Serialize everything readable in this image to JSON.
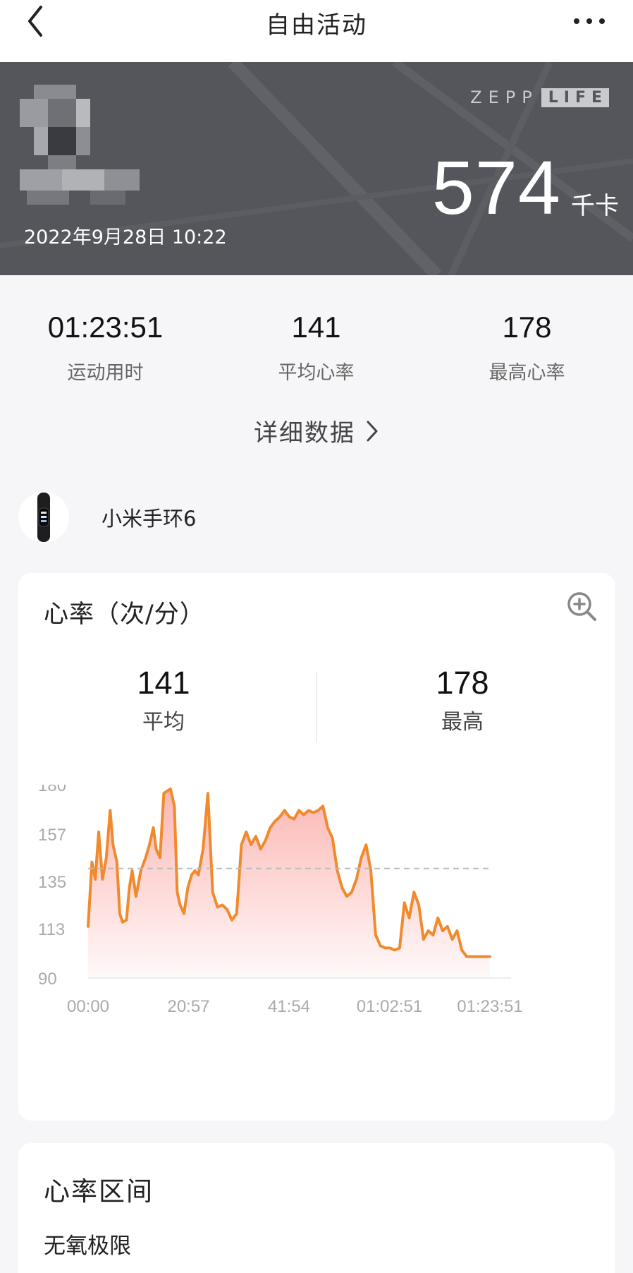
{
  "nav": {
    "title": "自由活动",
    "back_icon": "chevron-left-icon",
    "more_icon": "more-dots-icon"
  },
  "hero": {
    "brand_left": "ZEPP",
    "brand_right": "LIFE",
    "date": "2022年9月28日 10:22",
    "calories": "574",
    "calories_unit": "千卡"
  },
  "stats": [
    {
      "value": "01:23:51",
      "label": "运动用时"
    },
    {
      "value": "141",
      "label": "平均心率"
    },
    {
      "value": "178",
      "label": "最高心率"
    }
  ],
  "detail_link": "详细数据",
  "device": {
    "name": "小米手环6"
  },
  "heart_rate_card": {
    "title": "心率（次/分）",
    "zoom_icon": "zoom-in-icon",
    "avg_value": "141",
    "avg_label": "平均",
    "max_value": "178",
    "max_label": "最高"
  },
  "chart_data": {
    "type": "area",
    "title": "",
    "xlabel": "",
    "ylabel": "",
    "ylim": [
      90,
      180
    ],
    "yticks": [
      180,
      157,
      135,
      113,
      90
    ],
    "xtick_labels": [
      "00:00",
      "20:57",
      "41:54",
      "01:02:51",
      "01:23:51"
    ],
    "xlim_minutes": [
      0,
      83.85
    ],
    "reference_line": {
      "value": 141,
      "style": "dashed"
    },
    "line_color": "#f08a2c",
    "fill_color": "#fbb3b0",
    "x_minutes": [
      0,
      0.8,
      1.5,
      2.2,
      3,
      3.8,
      4.6,
      5.2,
      6,
      6.6,
      7.2,
      8,
      8.6,
      9.2,
      10,
      11,
      12,
      12.8,
      13.6,
      14.2,
      15,
      15.8,
      16.5,
      17.2,
      18,
      18.6,
      19.2,
      20,
      20.8,
      21.6,
      22.3,
      23,
      24,
      25,
      26,
      27,
      28,
      29,
      30,
      31,
      32,
      33,
      34,
      35,
      36,
      37,
      38,
      39,
      40,
      41,
      42,
      43,
      44,
      45,
      46,
      47,
      48,
      49,
      50,
      51,
      52,
      53,
      54,
      55,
      56,
      57,
      58,
      59,
      60,
      61,
      62,
      63,
      64,
      65,
      66,
      67,
      68,
      69,
      70,
      71,
      72,
      73,
      74,
      75,
      76,
      77,
      78,
      79,
      80,
      81,
      82,
      83,
      83.85
    ],
    "y_bpm": [
      114,
      144,
      136,
      158,
      136,
      146,
      168,
      152,
      144,
      120,
      116,
      117,
      132,
      140,
      128,
      140,
      146,
      152,
      160,
      150,
      146,
      176,
      177,
      178,
      170,
      130,
      124,
      120,
      132,
      138,
      140,
      138,
      150,
      176,
      130,
      123,
      124,
      122,
      117,
      120,
      152,
      158,
      152,
      156,
      150,
      154,
      160,
      163,
      165,
      168,
      165,
      164,
      168,
      166,
      168,
      167,
      168,
      170,
      160,
      155,
      140,
      132,
      128,
      130,
      136,
      146,
      152,
      140,
      110,
      105,
      104,
      104,
      103,
      104,
      125,
      118,
      130,
      124,
      108,
      112,
      110,
      118,
      112,
      114,
      108,
      112,
      103,
      100,
      100,
      100,
      100,
      100,
      100
    ]
  },
  "zones_card": {
    "title": "心率区间",
    "first_zone": "无氧极限"
  }
}
